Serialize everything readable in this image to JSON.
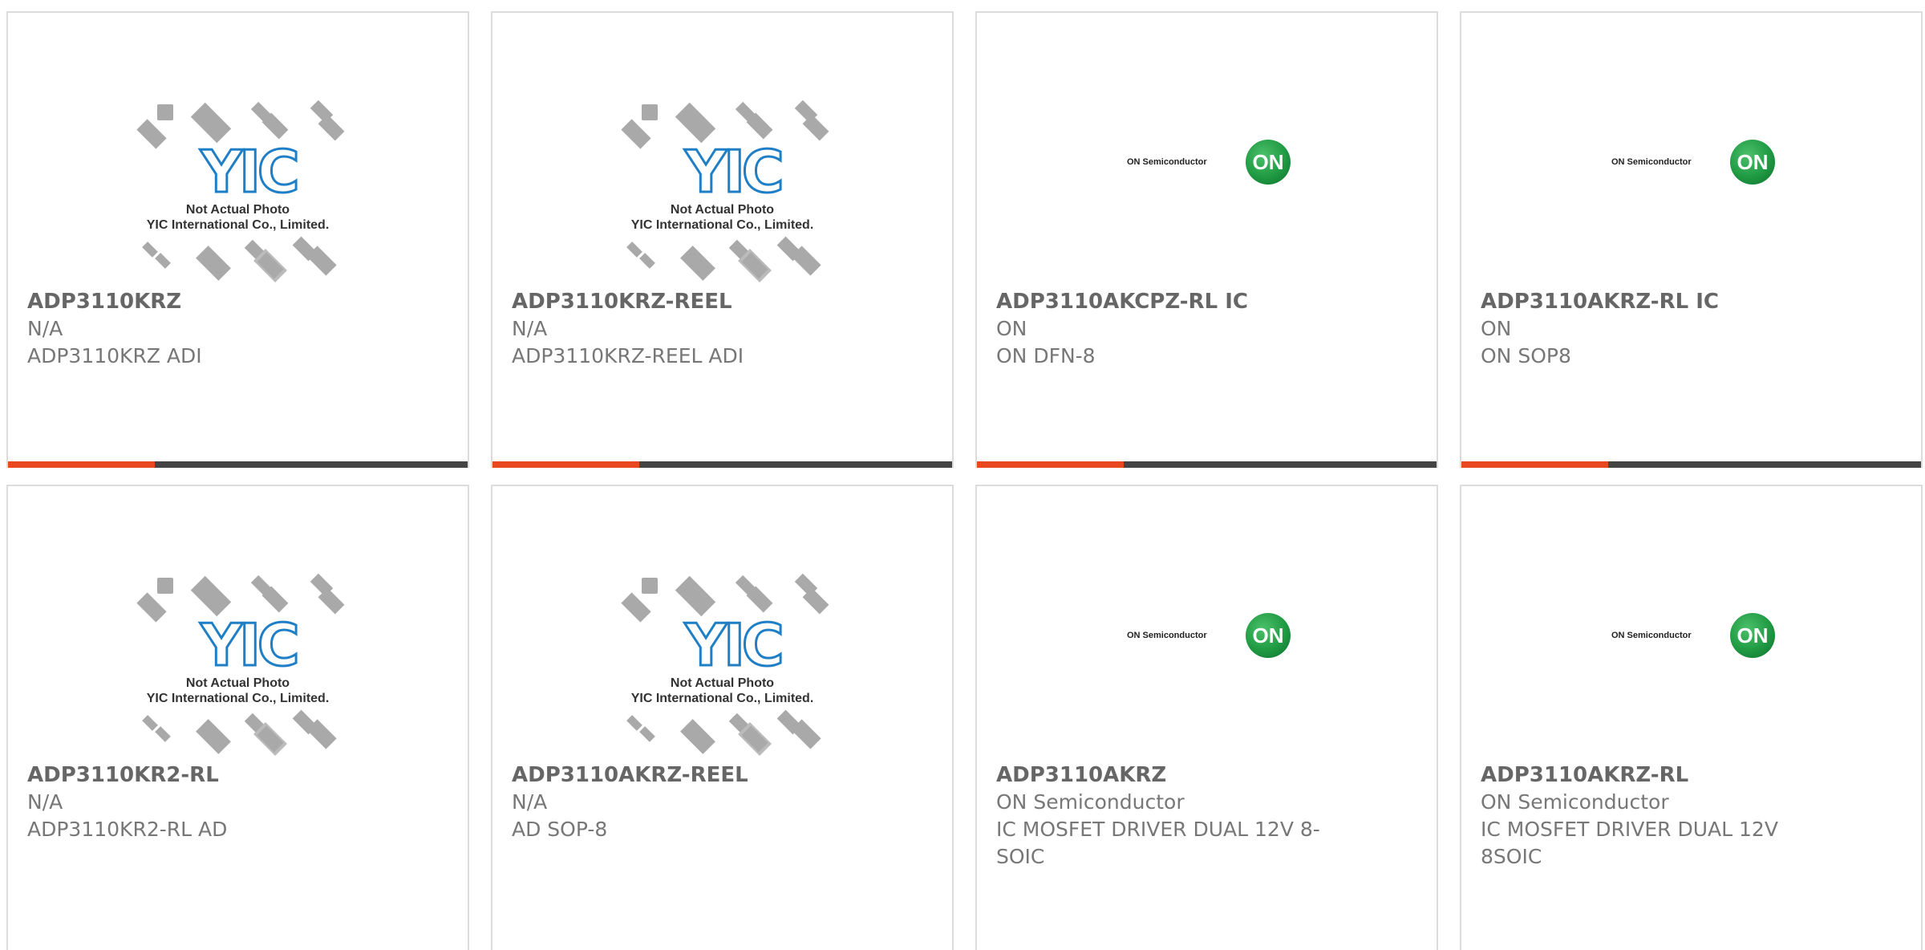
{
  "placeholder": {
    "brand_mark": "YIC",
    "line1": "Not Actual Photo",
    "line2": "YIC International Co., Limited."
  },
  "onsemi": {
    "wordmark": "ON Semiconductor",
    "badge": "ON",
    "badge_color": "#1f9a43"
  },
  "colors": {
    "accent": "#e8471f",
    "bar": "#444444",
    "text": "#777777",
    "border": "#dcdcdc",
    "yic_blue": "#1f7fc6"
  },
  "products": [
    {
      "part": "ADP3110KRZ",
      "manufacturer": "N/A",
      "description": "ADP3110KRZ ADI",
      "image": "yic-placeholder"
    },
    {
      "part": "ADP3110KRZ-REEL",
      "manufacturer": "N/A",
      "description": "ADP3110KRZ-REEL ADI",
      "image": "yic-placeholder"
    },
    {
      "part": "ADP3110AKCPZ-RL IC",
      "manufacturer": "ON",
      "description": "ON DFN-8",
      "image": "onsemi-logo"
    },
    {
      "part": "ADP3110AKRZ-RL IC",
      "manufacturer": "ON",
      "description": "ON SOP8",
      "image": "onsemi-logo"
    },
    {
      "part": "ADP3110KR2-RL",
      "manufacturer": "N/A",
      "description": "ADP3110KR2-RL AD",
      "image": "yic-placeholder"
    },
    {
      "part": "ADP3110AKRZ-REEL",
      "manufacturer": "N/A",
      "description": "AD SOP-8",
      "image": "yic-placeholder"
    },
    {
      "part": "ADP3110AKRZ",
      "manufacturer": "ON Semiconductor",
      "description": "IC MOSFET DRIVER DUAL 12V 8-",
      "description2": "SOIC",
      "image": "onsemi-logo"
    },
    {
      "part": "ADP3110AKRZ-RL",
      "manufacturer": "ON Semiconductor",
      "description": "IC MOSFET DRIVER DUAL 12V",
      "description2": "8SOIC",
      "image": "onsemi-logo"
    }
  ]
}
